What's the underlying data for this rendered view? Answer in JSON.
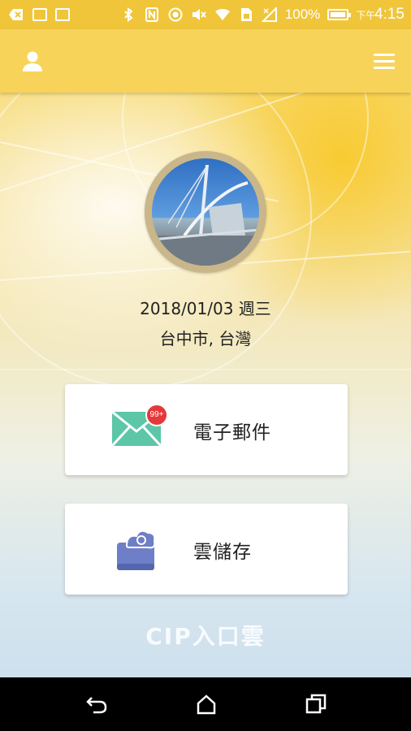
{
  "status_bar": {
    "battery_percent": "100%",
    "time_prefix": "下午",
    "time": "4:15",
    "icons": [
      "notification-icon",
      "code-icon",
      "code-icon",
      "bluetooth-icon",
      "nfc-icon",
      "target-icon",
      "mute-icon",
      "wifi-icon",
      "sim-icon",
      "signal-icon",
      "battery-icon"
    ]
  },
  "app_bar": {
    "left_icon": "user-icon",
    "right_icon": "menu-icon",
    "color": "#f7d35a"
  },
  "profile": {
    "date": "2018/01/03 週三",
    "location": "台中市, 台灣"
  },
  "cards": [
    {
      "label": "電子郵件",
      "icon": "mail-icon",
      "badge": "99+"
    },
    {
      "label": "雲儲存",
      "icon": "cloud-storage-icon"
    }
  ],
  "brand": "CIP入口雲",
  "nav_bar": {
    "icons": [
      "back-icon",
      "home-icon",
      "recent-apps-icon"
    ]
  }
}
